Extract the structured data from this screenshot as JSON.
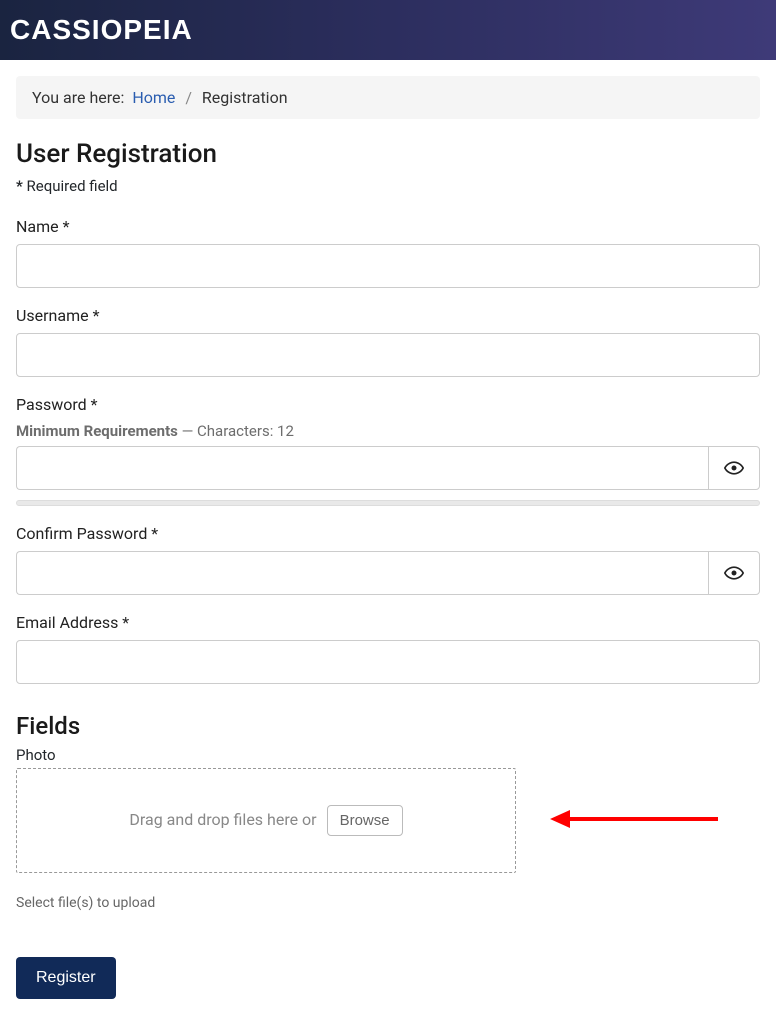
{
  "header": {
    "logo": "CASSIOPEIA"
  },
  "breadcrumb": {
    "prefix": "You are here:",
    "home": "Home",
    "sep": "/",
    "current": "Registration"
  },
  "page": {
    "title": "User Registration",
    "required_star": "*",
    "required_text": " Required field"
  },
  "form": {
    "name_label": "Name *",
    "username_label": "Username *",
    "password_label": "Password *",
    "password_hint_bold": "Minimum Requirements",
    "password_hint_rest": " — Characters: 12",
    "confirm_label": "Confirm Password *",
    "email_label": "Email Address *"
  },
  "fields_section": {
    "title": "Fields",
    "photo_label": "Photo",
    "drop_text": "Drag and drop files here or ",
    "browse": "Browse",
    "hint": "Select file(s) to upload"
  },
  "actions": {
    "register": "Register"
  }
}
